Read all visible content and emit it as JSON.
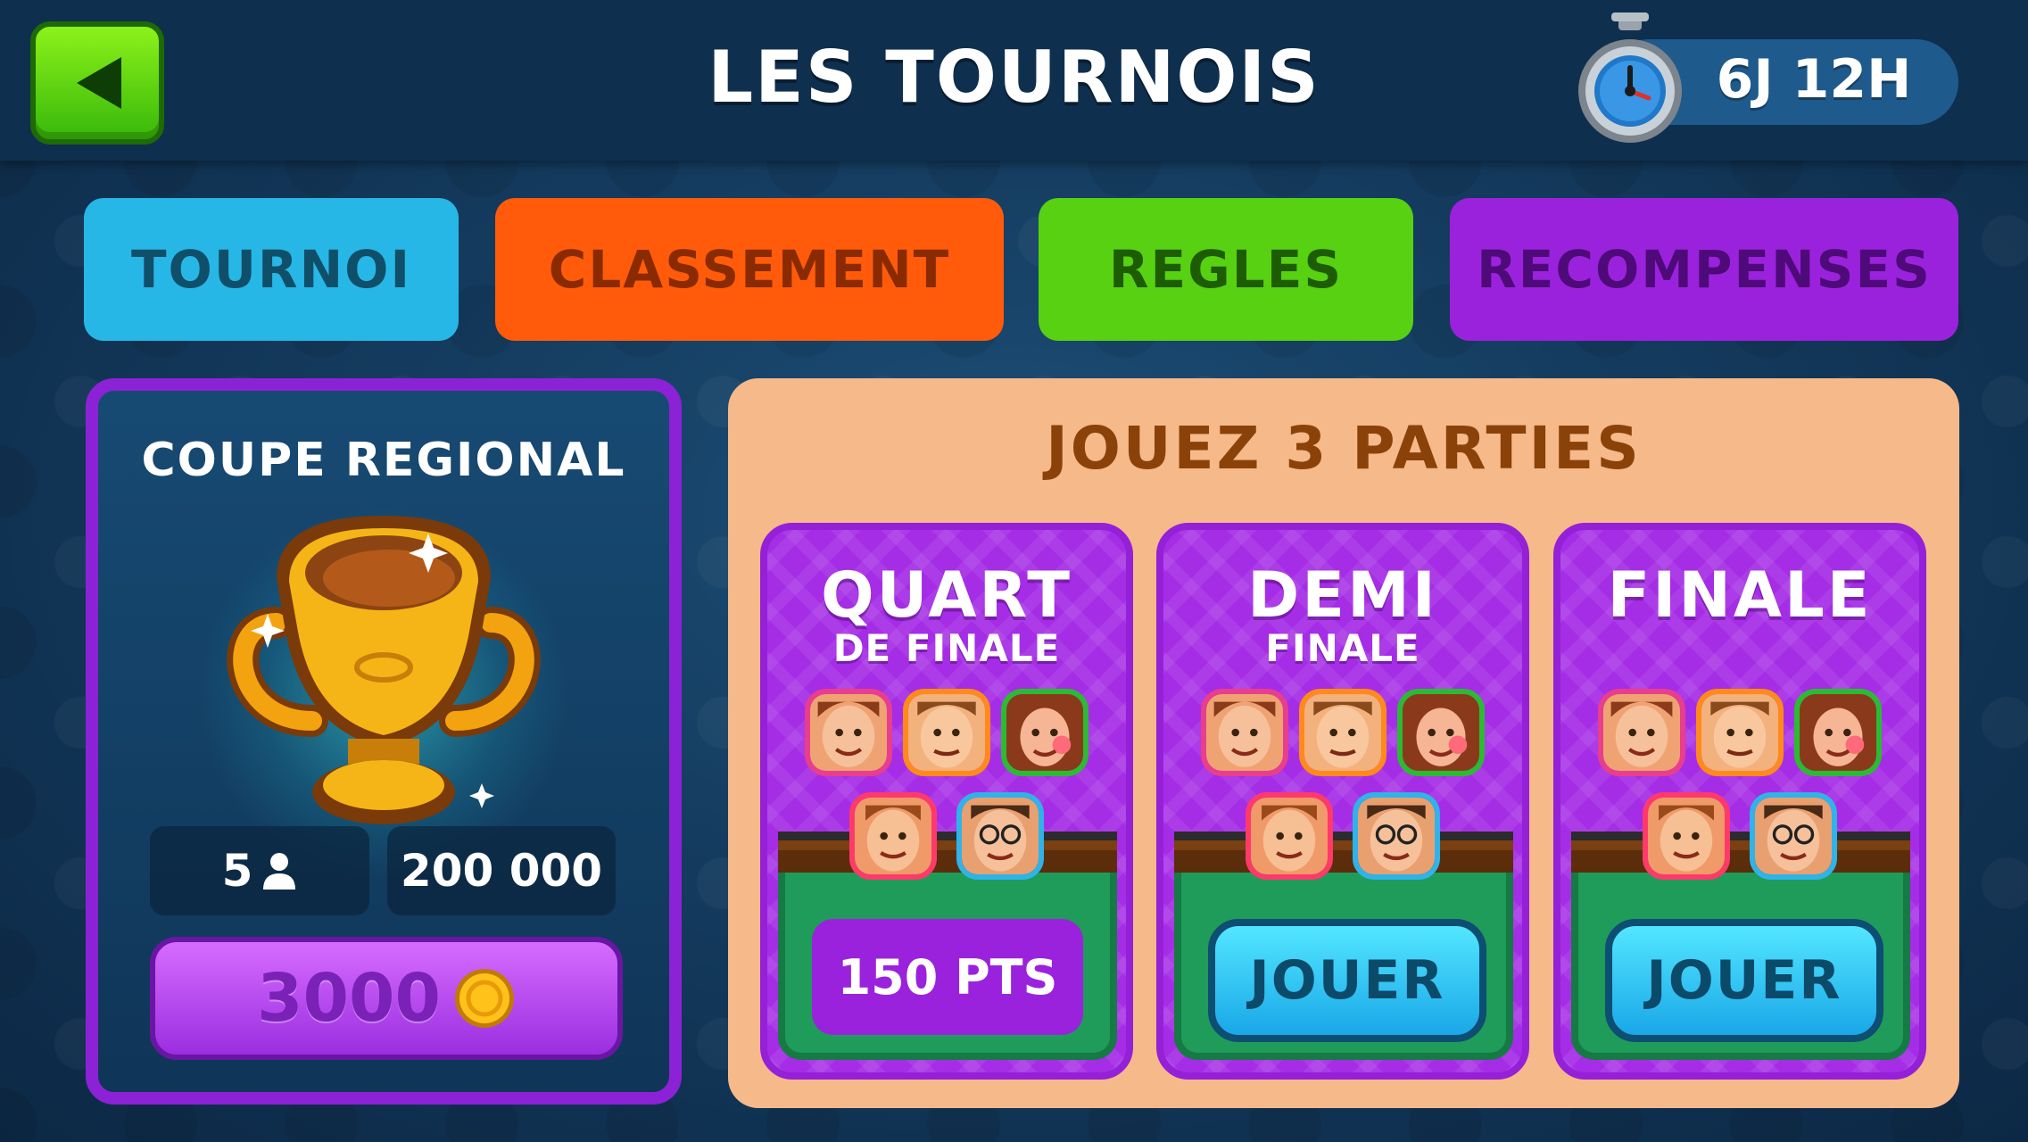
{
  "header": {
    "title": "LES TOURNOIS",
    "timer": "6J 12H"
  },
  "tabs": [
    {
      "label": "TOURNOI",
      "color": "#27b7e6"
    },
    {
      "label": "CLASSEMENT",
      "color": "#ff5b0a"
    },
    {
      "label": "REGLES",
      "color": "#57d111"
    },
    {
      "label": "RECOMPENSES",
      "color": "#9b22dc"
    }
  ],
  "tournament": {
    "name": "COUPE REGIONAL",
    "players": "5",
    "prize": "200 000",
    "entry_cost": "3000",
    "icons": [
      "trophy-icon",
      "person-icon",
      "coin-icon"
    ]
  },
  "stages": {
    "title": "JOUEZ 3 PARTIES",
    "cards": [
      {
        "title": "QUART",
        "subtitle": "DE FINALE",
        "action": "150 PTS"
      },
      {
        "title": "DEMI",
        "subtitle": "FINALE",
        "action": "JOUER"
      },
      {
        "title": "FINALE",
        "subtitle": "",
        "action": "JOUER"
      }
    ]
  },
  "colors": {
    "back_button": "#4fd10f",
    "panel_border": "#8c22d6",
    "stage_panel": "#f6b98a",
    "play_button": "#2bc3f2"
  }
}
